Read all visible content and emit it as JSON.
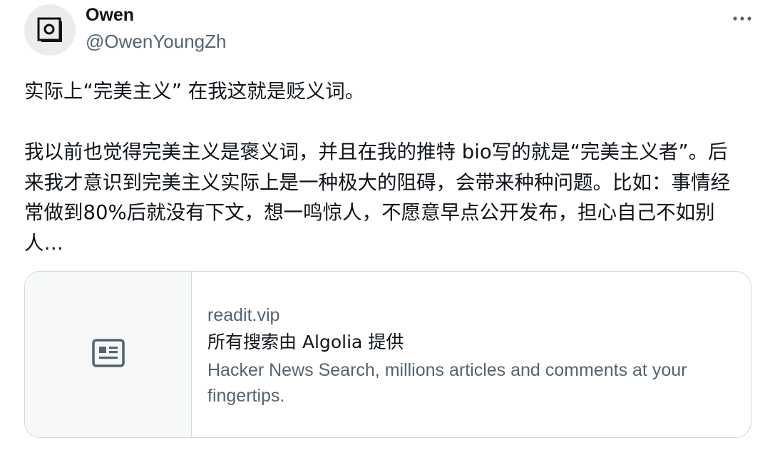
{
  "author": {
    "name": "Owen",
    "handle": "@OwenYoungZh",
    "avatar_icon": "window-logo-icon"
  },
  "more_icon": "more-horizontal-icon",
  "tweet": {
    "paragraphs": [
      "实际上“完美主义” 在我这就是贬义词。",
      "我以前也觉得完美主义是褒义词，并且在我的推特 bio写的就是“完美主义者”。后来我才意识到完美主义实际上是一种极大的阻碍，会带来种种问题。比如：事情经常做到80%后就没有下文，想一鸣惊人，不愿意早点公开发布，担心自己不如别人…"
    ]
  },
  "link_card": {
    "thumb_icon": "article-icon",
    "domain": "readit.vip",
    "title": "所有搜索由 Algolia 提供",
    "description": "Hacker News Search, millions articles and comments at your fingertips."
  },
  "colors": {
    "text_primary": "#0f1419",
    "text_secondary": "#536471",
    "border": "#cfd9de",
    "thumb_bg": "#f7f9f9"
  }
}
